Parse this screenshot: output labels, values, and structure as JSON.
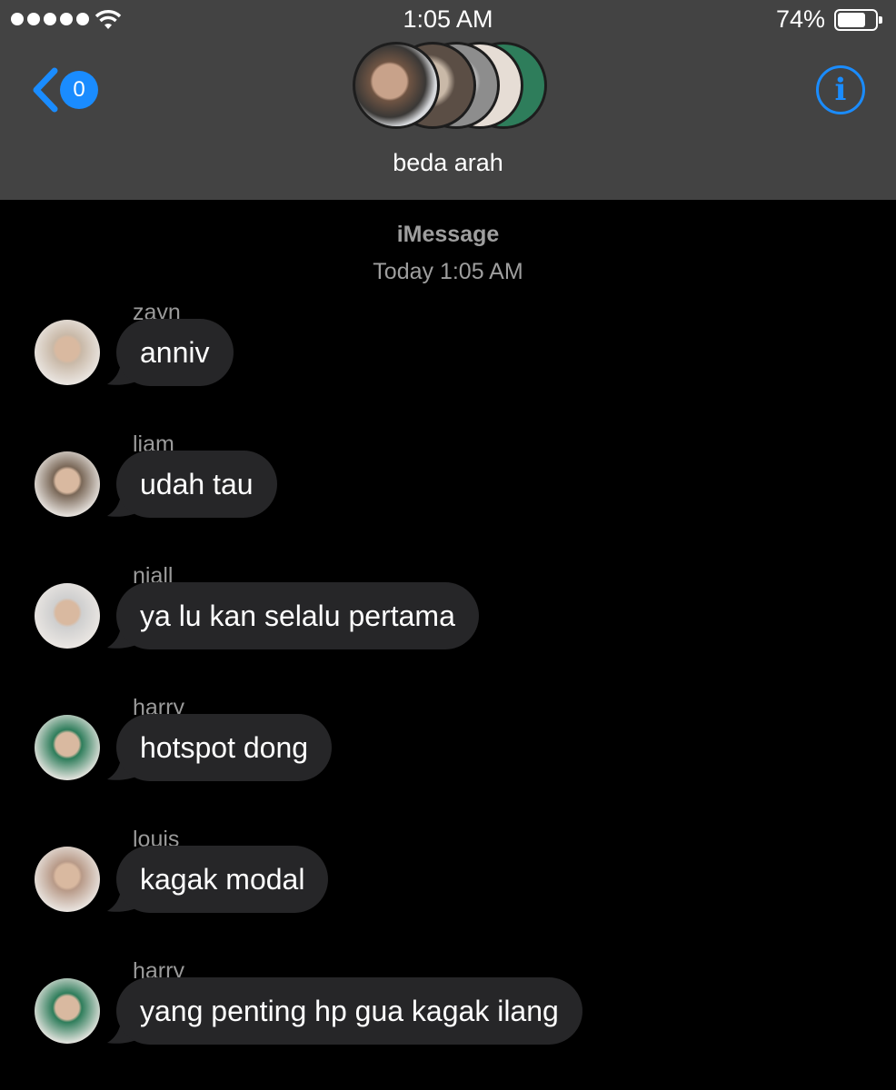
{
  "status": {
    "time": "1:05 AM",
    "battery_percent": "74%",
    "battery_level": 0.74,
    "signal_bars": 5
  },
  "header": {
    "back_badge": "0",
    "group_name": "beda arah",
    "info_icon": "info-icon"
  },
  "conversation": {
    "service": "iMessage",
    "timestamp": "Today 1:05 AM",
    "messages": [
      {
        "sender": "zayn",
        "text": "anniv",
        "avatar_color": "#c9b9a8"
      },
      {
        "sender": "liam",
        "text": "udah tau",
        "avatar_color": "#7a6858"
      },
      {
        "sender": "niall",
        "text": "ya lu kan selalu pertama",
        "avatar_color": "#cfcfcf"
      },
      {
        "sender": "harry",
        "text": "hotspot dong",
        "avatar_color": "#2e7d5b"
      },
      {
        "sender": "louis",
        "text": "kagak modal",
        "avatar_color": "#b89a88"
      },
      {
        "sender": "harry",
        "text": "yang penting hp gua kagak ilang",
        "avatar_color": "#2e7d5b"
      }
    ]
  },
  "colors": {
    "header_bg": "#434343",
    "accent": "#1a8cff",
    "bubble": "#262628",
    "meta_text": "#9e9e9e"
  }
}
